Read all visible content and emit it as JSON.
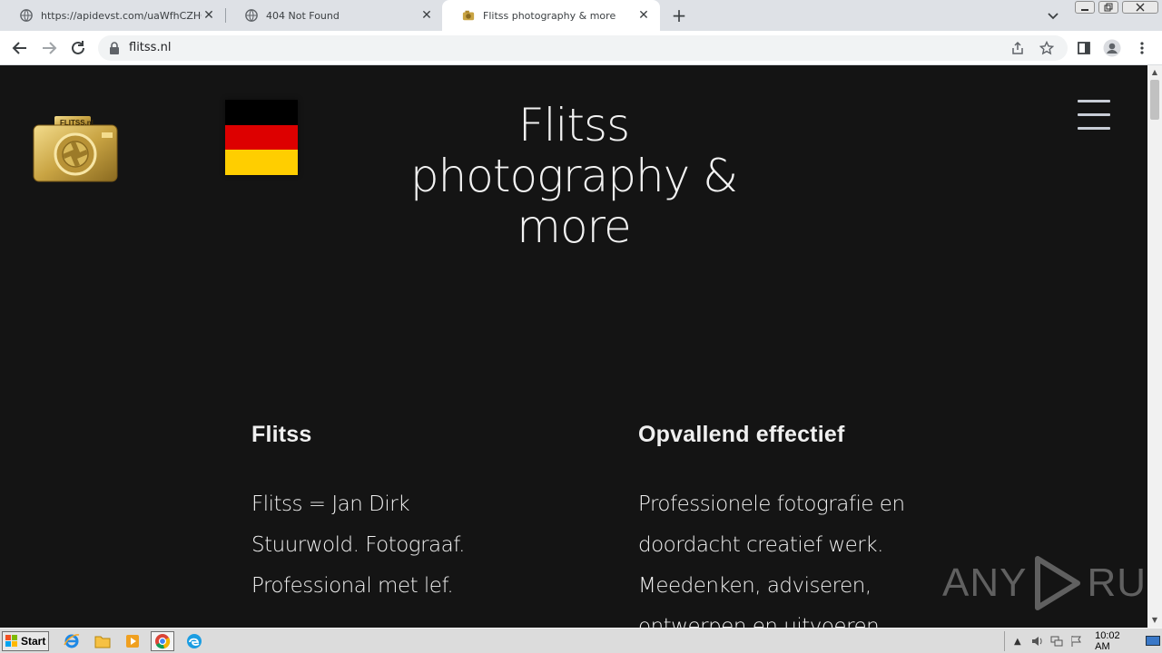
{
  "browser": {
    "tabs": [
      {
        "title": "https://apidevst.com/uaWfhCZHOIP",
        "active": false
      },
      {
        "title": "404 Not Found",
        "active": false
      },
      {
        "title": "Flitss photography & more",
        "active": true
      }
    ],
    "new_tab_label": "+",
    "close_label": "✕",
    "url": "flitss.nl"
  },
  "page": {
    "logo_text": "FLITSS.nl",
    "site_title": "Flitss photography & more",
    "flag_colors": [
      "#000000",
      "#dd0000",
      "#ffce00"
    ],
    "columns": [
      {
        "heading": "Flitss",
        "lines": [
          "Flitss = Jan Dirk",
          "Stuurwold. Fotograaf.",
          "Professional met lef."
        ]
      },
      {
        "heading": "Opvallend effectief",
        "lines": [
          "Professionele fotografie en",
          "doordacht creatief werk.",
          "Meedenken, adviseren,",
          "ontwerpen en uitvoeren."
        ]
      }
    ],
    "watermark": {
      "left": "ANY",
      "right": "RUN"
    }
  },
  "taskbar": {
    "start_label": "Start",
    "clock": "10:02 AM"
  },
  "colors": {
    "page_bg": "#141414",
    "text": "#f0f0f0",
    "accent_gold": "#c9a443"
  }
}
